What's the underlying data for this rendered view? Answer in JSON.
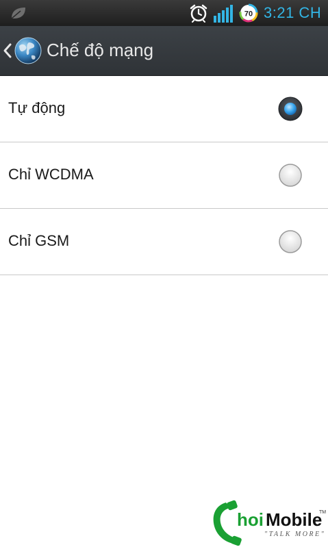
{
  "status_bar": {
    "time": "3:21 CH",
    "battery_level": "70",
    "icons": [
      "leaf-icon",
      "alarm-clock-icon",
      "signal-strength-icon",
      "battery-icon"
    ]
  },
  "action_bar": {
    "title": "Chế độ mạng",
    "back_icon": "chevron-left-icon",
    "app_icon": "globe-icon"
  },
  "options": [
    {
      "label": "Tự động",
      "selected": true
    },
    {
      "label": "Chỉ WCDMA",
      "selected": false
    },
    {
      "label": "Chỉ GSM",
      "selected": false
    }
  ],
  "watermark": {
    "brand_prefix": "hoi",
    "brand_main": "Mobile",
    "tagline": "\"TALK MORE\"",
    "trademark": "TM"
  },
  "colors": {
    "accent": "#33b5e5",
    "status_bar_bg": "#1e1e1e",
    "action_bar_bg": "#353a3f",
    "divider": "#c8c8c8",
    "watermark_green": "#1aa033"
  }
}
